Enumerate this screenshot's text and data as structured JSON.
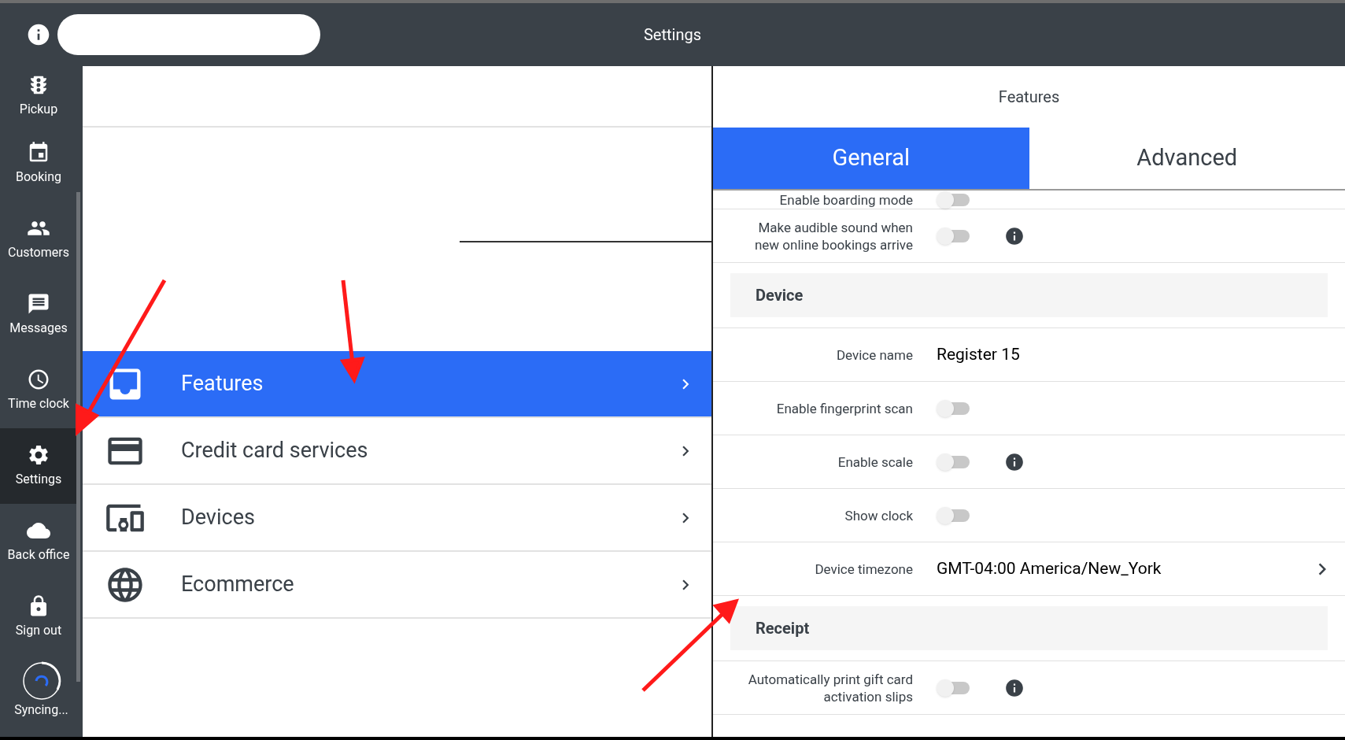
{
  "header": {
    "title": "Settings"
  },
  "sidebar": {
    "items": [
      {
        "label": "Pickup",
        "selected": false
      },
      {
        "label": "Booking",
        "selected": false
      },
      {
        "label": "Customers",
        "selected": false
      },
      {
        "label": "Messages",
        "selected": false
      },
      {
        "label": "Time clock",
        "selected": false
      },
      {
        "label": "Settings",
        "selected": true
      },
      {
        "label": "Back office",
        "selected": false
      },
      {
        "label": "Sign out",
        "selected": false
      }
    ],
    "sync": {
      "label": "Syncing..."
    }
  },
  "menu": {
    "items": [
      {
        "label": "Features",
        "selected": true
      },
      {
        "label": "Credit card services",
        "selected": false
      },
      {
        "label": "Devices",
        "selected": false
      },
      {
        "label": "Ecommerce",
        "selected": false
      }
    ]
  },
  "detail": {
    "title": "Features",
    "tabs": [
      {
        "label": "General",
        "selected": true
      },
      {
        "label": "Advanced",
        "selected": false
      }
    ],
    "rows": [
      {
        "kind": "toggle",
        "label": "Enable boarding mode",
        "on": false,
        "info": false
      },
      {
        "kind": "toggle",
        "label": "Make audible sound when new online bookings arrive",
        "on": false,
        "info": true
      },
      {
        "kind": "section",
        "label": "Device"
      },
      {
        "kind": "text",
        "label": "Device name",
        "value": "Register 15"
      },
      {
        "kind": "toggle",
        "label": "Enable fingerprint scan",
        "on": false,
        "info": false
      },
      {
        "kind": "toggle",
        "label": "Enable scale",
        "on": false,
        "info": true
      },
      {
        "kind": "toggle",
        "label": "Show clock",
        "on": false,
        "info": false
      },
      {
        "kind": "link",
        "label": "Device timezone",
        "value": "GMT-04:00 America/New_York"
      },
      {
        "kind": "section",
        "label": "Receipt"
      },
      {
        "kind": "toggle",
        "label": "Automatically print gift card activation slips",
        "on": false,
        "info": true
      }
    ]
  }
}
